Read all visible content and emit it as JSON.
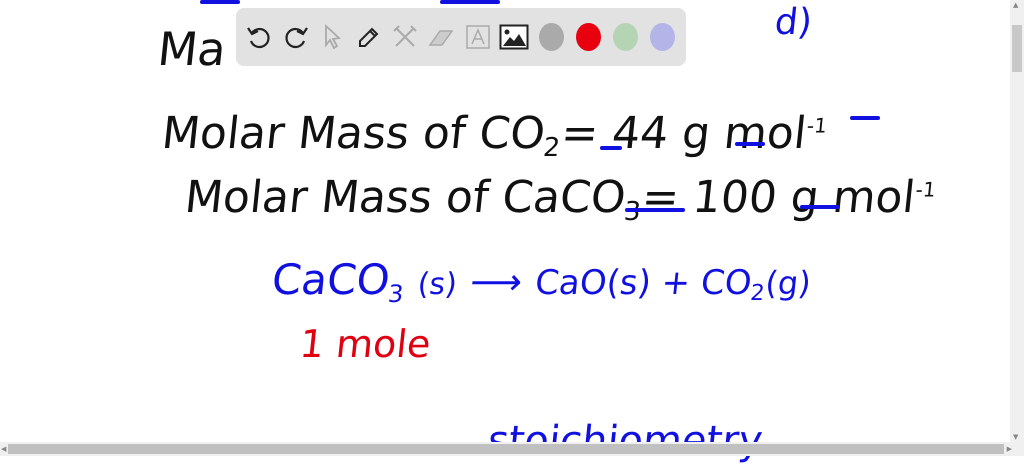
{
  "toolbar": {
    "tools": [
      "undo",
      "redo",
      "select",
      "pen",
      "tools",
      "eraser",
      "text",
      "image"
    ],
    "colors": [
      "#aaaaaa",
      "#e8000f",
      "#b4d4b4",
      "#b4b4e8"
    ]
  },
  "board": {
    "line1": "Ma",
    "line1_right": "d)",
    "line2": "Molar Mass of CO",
    "line2_sub": "2",
    "line2_val": "= 44 g mol",
    "line2_sup": "-1",
    "line3": "Molar Mass of CaCO",
    "line3_sub": "3",
    "line3_val": "= 100 g mol",
    "line3_sup": "-1",
    "reaction_left": "CaCO",
    "reaction_left_sub": "3",
    "reaction_left_state": "(s)",
    "reaction_arrow": "⟶",
    "reaction_right": "CaO(s) + CO",
    "reaction_right_sub": "2",
    "reaction_right_state": "(g)",
    "mole_note": "1 mole",
    "bottom_word": "stoichiometry"
  }
}
